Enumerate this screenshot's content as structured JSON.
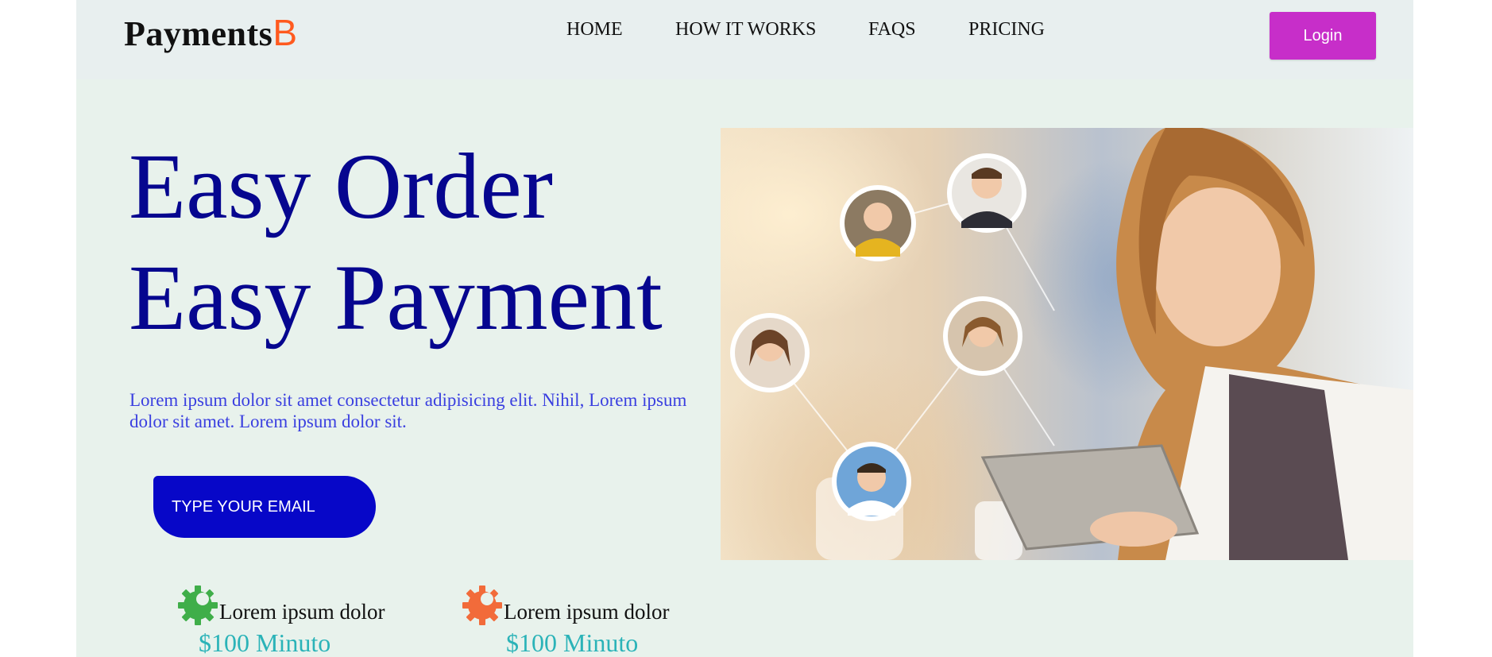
{
  "navbar": {
    "logo_text": "Payments",
    "logo_accent": "B",
    "links": [
      "HOME",
      "HOW IT WORKS",
      "FAQS",
      "PRICING"
    ],
    "login_label": "Login"
  },
  "hero": {
    "title_line1": "Easy Order",
    "title_line2": "Easy Payment",
    "description": "Lorem ipsum dolor sit amet consectetur adipisicing elit. Nihil, Lorem ipsum dolor sit amet. Lorem ipsum dolor sit.",
    "email_placeholder": "TYPE YOUR EMAIL"
  },
  "features": [
    {
      "icon": "gear-icon",
      "icon_color": "#3fae49",
      "label": "Lorem ipsum dolor",
      "price": "$100 Minuto"
    },
    {
      "icon": "gear-icon",
      "icon_color": "#f26b3a",
      "label": "Lorem ipsum dolor",
      "price": "$100 Minuto"
    }
  ],
  "colors": {
    "frame_bg": "#e8f2ec",
    "navbar_bg": "#e8efef",
    "logo_accent": "#ff5a1f",
    "login_button": "#c72ec9",
    "title": "#06068f",
    "description": "#3a3fe0",
    "email_input_bg": "#0707c8",
    "price": "#2bb3b8"
  }
}
